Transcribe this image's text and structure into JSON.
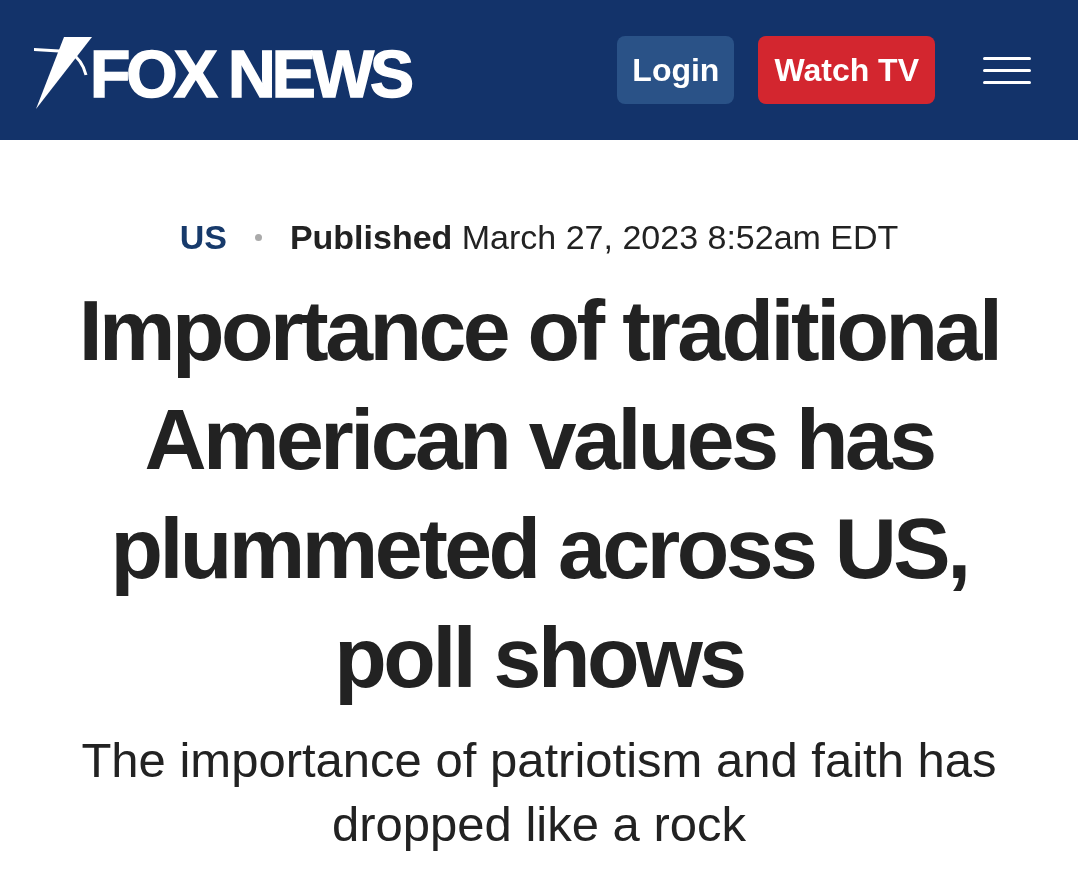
{
  "header": {
    "logo": {
      "text": "FOX NEWS"
    },
    "buttons": [
      {
        "label": "Login",
        "kind": "secondary"
      },
      {
        "label": "Watch TV",
        "kind": "primary"
      }
    ]
  },
  "article": {
    "category": "US",
    "published": "**Published** March 27, 2023 8:52am EDT",
    "headline": "Importance of traditional American values has plummeted across US, poll shows",
    "subheadline": "The importance of patriotism and faith has dropped like a rock"
  }
}
